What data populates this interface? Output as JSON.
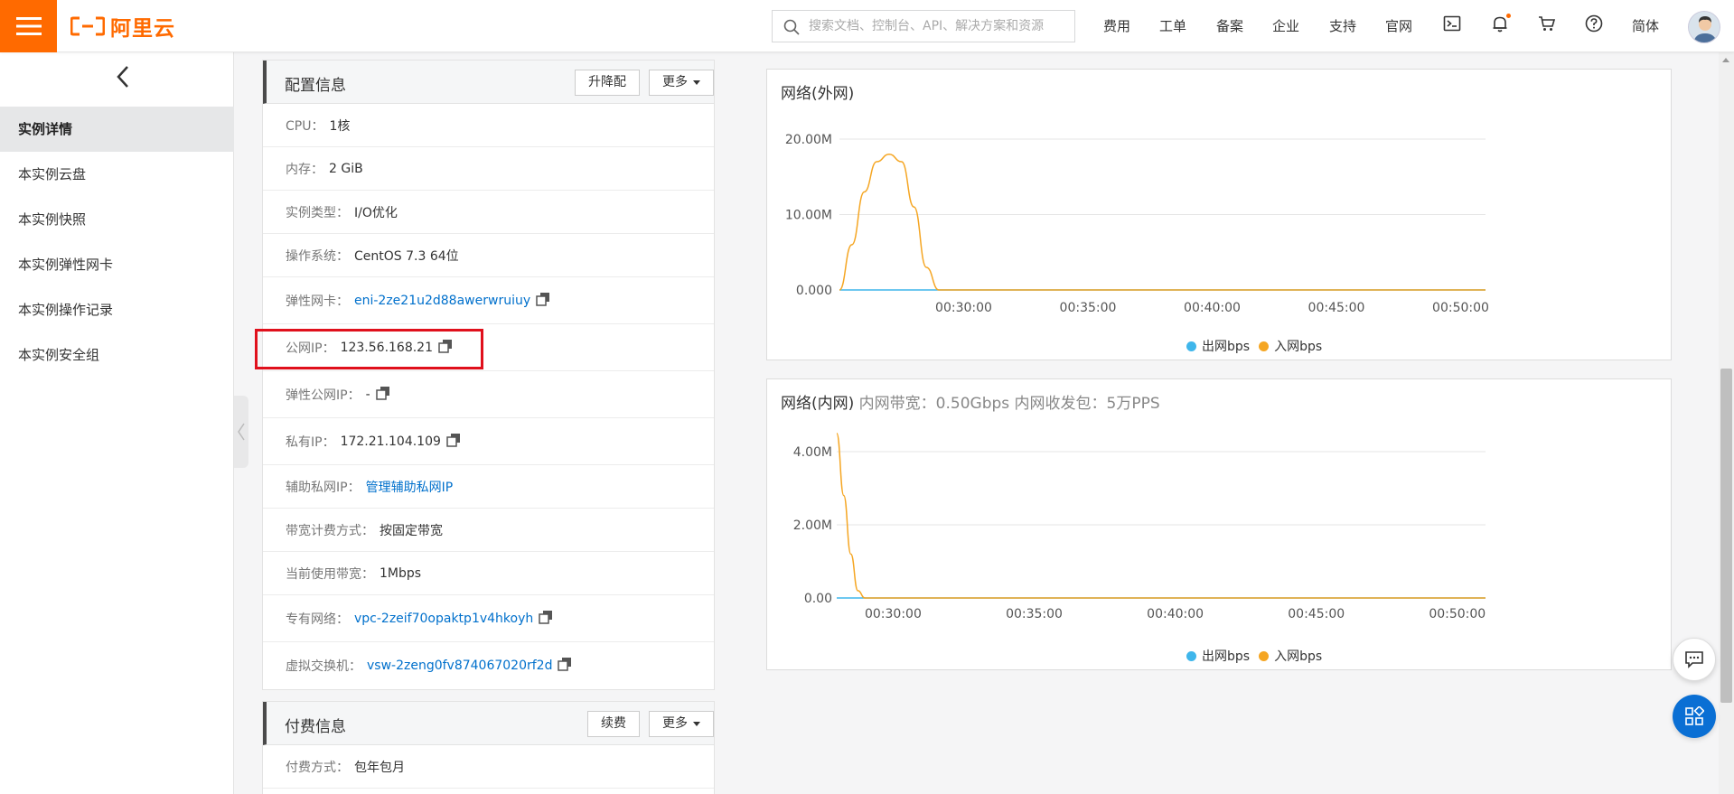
{
  "header": {
    "logo_text": "阿里云",
    "search_placeholder": "搜索文档、控制台、API、解决方案和资源",
    "nav": [
      "费用",
      "工单",
      "备案",
      "企业",
      "支持",
      "官网"
    ],
    "language": "简体",
    "icons": [
      "terminal-icon",
      "bell-icon",
      "cart-icon",
      "help-icon"
    ],
    "accent": "#ff6a00"
  },
  "sidebar": {
    "items": [
      {
        "label": "实例详情",
        "active": true
      },
      {
        "label": "本实例云盘"
      },
      {
        "label": "本实例快照"
      },
      {
        "label": "本实例弹性网卡"
      },
      {
        "label": "本实例操作记录"
      },
      {
        "label": "本实例安全组"
      }
    ]
  },
  "config": {
    "title": "配置信息",
    "upgrade_label": "升降配",
    "more_label": "更多",
    "rows": [
      {
        "label": "CPU：",
        "value": "1核"
      },
      {
        "label": "内存：",
        "value": "2 GiB"
      },
      {
        "label": "实例类型：",
        "value": "I/O优化"
      },
      {
        "label": "操作系统：",
        "value": "CentOS 7.3 64位"
      },
      {
        "label": "弹性网卡：",
        "value": "eni-2ze21u2d88awerwruiuy",
        "link": true,
        "copy": true
      },
      {
        "label": "公网IP：",
        "value": "123.56.168.21",
        "copy": true
      },
      {
        "label": "弹性公网IP：",
        "value": "-",
        "copy": true
      },
      {
        "label": "私有IP：",
        "value": "172.21.104.109",
        "copy": true
      },
      {
        "label": "辅助私网IP：",
        "value": "管理辅助私网IP",
        "link": true
      },
      {
        "label": "带宽计费方式：",
        "value": "按固定带宽"
      },
      {
        "label": "当前使用带宽：",
        "value": "1Mbps"
      },
      {
        "label": "专有网络：",
        "value": "vpc-2zeif70opaktp1v4hkoyh",
        "link": true,
        "copy": true
      },
      {
        "label": "虚拟交换机：",
        "value": "vsw-2zeng0fv874067020rf2d",
        "link": true,
        "copy": true
      }
    ]
  },
  "billing": {
    "title": "付费信息",
    "renew_label": "续费",
    "more_label": "更多",
    "rows": [
      {
        "label": "付费方式：",
        "value": "包年包月"
      }
    ]
  },
  "chart_data": [
    {
      "type": "line",
      "title": "网络(外网)",
      "subtitle": "",
      "x_ticks": [
        "00:30:00",
        "00:35:00",
        "00:40:00",
        "00:45:00",
        "00:50:00"
      ],
      "y_ticks": [
        "0.000",
        "10.00M",
        "20.00M"
      ],
      "ylim": [
        0,
        20000000
      ],
      "x_range": [
        "00:25:00",
        "00:51:00"
      ],
      "grid": true,
      "legend_position": "bottom-center",
      "series": [
        {
          "name": "出网bps",
          "color": "#3fb6eb",
          "x": [
            "00:25:00",
            "00:51:00"
          ],
          "values": [
            0,
            0
          ]
        },
        {
          "name": "入网bps",
          "color": "#f5a623",
          "x": [
            "00:25:00",
            "00:25:30",
            "00:26:00",
            "00:26:30",
            "00:27:00",
            "00:27:30",
            "00:28:00",
            "00:28:30",
            "00:29:00",
            "00:30:00",
            "00:40:00",
            "00:51:00"
          ],
          "values": [
            0,
            6000000,
            13000000,
            17000000,
            18000000,
            17000000,
            11000000,
            3000000,
            0,
            0,
            0,
            0
          ]
        }
      ]
    },
    {
      "type": "line",
      "title": "网络(内网)",
      "subtitle": "内网带宽：0.50Gbps 内网收发包：5万PPS",
      "x_ticks": [
        "00:30:00",
        "00:35:00",
        "00:40:00",
        "00:45:00",
        "00:50:00"
      ],
      "y_ticks": [
        "0.00",
        "2.00M",
        "4.00M"
      ],
      "ylim": [
        0,
        4000000
      ],
      "x_range": [
        "00:28:00",
        "00:51:00"
      ],
      "grid": true,
      "legend_position": "bottom-center",
      "series": [
        {
          "name": "出网bps",
          "color": "#3fb6eb",
          "x": [
            "00:28:00",
            "00:51:00"
          ],
          "values": [
            0,
            0
          ]
        },
        {
          "name": "入网bps",
          "color": "#f5a623",
          "x": [
            "00:28:00",
            "00:28:15",
            "00:28:30",
            "00:28:45",
            "00:29:00",
            "00:51:00"
          ],
          "values": [
            4500000,
            2800000,
            1200000,
            200000,
            0,
            0
          ]
        }
      ]
    }
  ]
}
